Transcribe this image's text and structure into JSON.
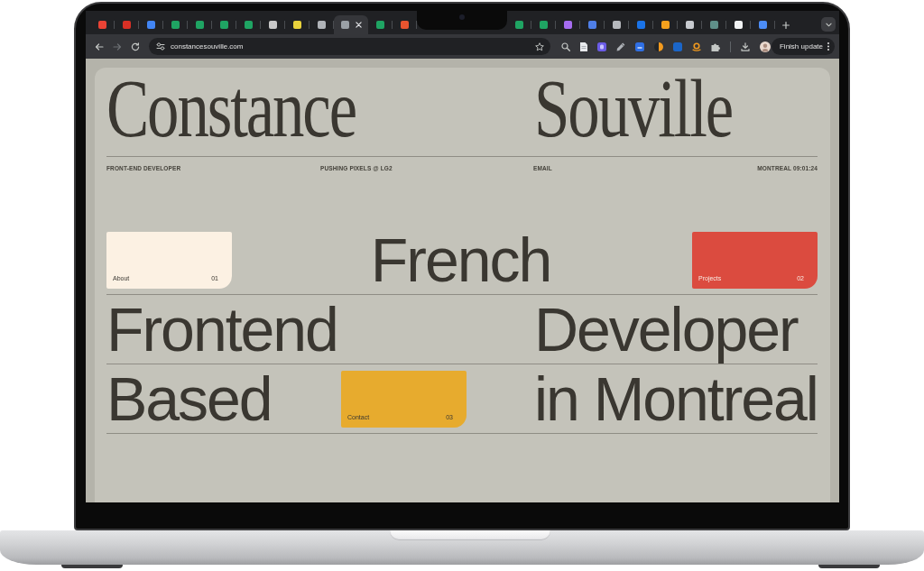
{
  "browser": {
    "tabs_before_notch": [
      {
        "selected": false,
        "color": "#ea4335"
      },
      {
        "selected": false,
        "color": "#d93025"
      },
      {
        "selected": false,
        "color": "#4285f4"
      },
      {
        "selected": false,
        "color": "#1fa463"
      },
      {
        "selected": false,
        "color": "#1fa463"
      },
      {
        "selected": false,
        "color": "#1fa463"
      },
      {
        "selected": false,
        "color": "#1fa463"
      },
      {
        "selected": false,
        "color": "#c8c8c8"
      },
      {
        "selected": false,
        "color": "#e9d23c"
      },
      {
        "selected": false,
        "color": "#b0b3b8"
      },
      {
        "selected": true,
        "color": "#9aa0a6"
      },
      {
        "selected": false,
        "color": "#1fa463"
      },
      {
        "selected": false,
        "color": "#e8542f"
      }
    ],
    "tabs_after_notch": [
      {
        "selected": false,
        "color": "#1fa463"
      },
      {
        "selected": false,
        "color": "#1fa463"
      },
      {
        "selected": false,
        "color": "#a66cf0"
      },
      {
        "selected": false,
        "color": "#4f7fe8"
      },
      {
        "selected": false,
        "color": "#b6b9bd"
      },
      {
        "selected": false,
        "color": "#1a73e8"
      },
      {
        "selected": false,
        "color": "#f4a11d"
      },
      {
        "selected": false,
        "color": "#c8cbd0"
      },
      {
        "selected": false,
        "color": "#5f8f89"
      },
      {
        "selected": false,
        "color": "#f1f3f4"
      },
      {
        "selected": false,
        "color": "#4c8df6"
      }
    ],
    "nav_buttons": [
      {
        "kind": "back",
        "disabled": false
      },
      {
        "kind": "forward",
        "disabled": true
      },
      {
        "kind": "reload",
        "disabled": false
      }
    ],
    "url": "constancesouville.com",
    "update_button": "Finish update"
  },
  "page": {
    "first_name": "Constance",
    "last_name": "Souville",
    "role": "FRONT-END DEVELOPER",
    "tagline": "PUSHING PIXELS @ LG2",
    "email_link": "EMAIL",
    "location_time": "MONTREAL 09:01:24",
    "headline_rows": [
      {
        "items": [
          {
            "kind": "card",
            "label": "About",
            "number": "01",
            "color": "#fcf1e3"
          },
          {
            "kind": "word",
            "text": "French"
          },
          {
            "kind": "card",
            "label": "Projects",
            "number": "02",
            "color": "#db4b3f"
          }
        ]
      },
      {
        "items": [
          {
            "kind": "word",
            "text": "Frontend"
          },
          {
            "kind": "word",
            "text": "Developer"
          }
        ]
      },
      {
        "items": [
          {
            "kind": "word",
            "text": "Based"
          },
          {
            "kind": "card",
            "label": "Contact",
            "number": "03",
            "color": "#e7ab2e"
          },
          {
            "kind": "word",
            "text": "in Montreal"
          }
        ]
      }
    ]
  }
}
